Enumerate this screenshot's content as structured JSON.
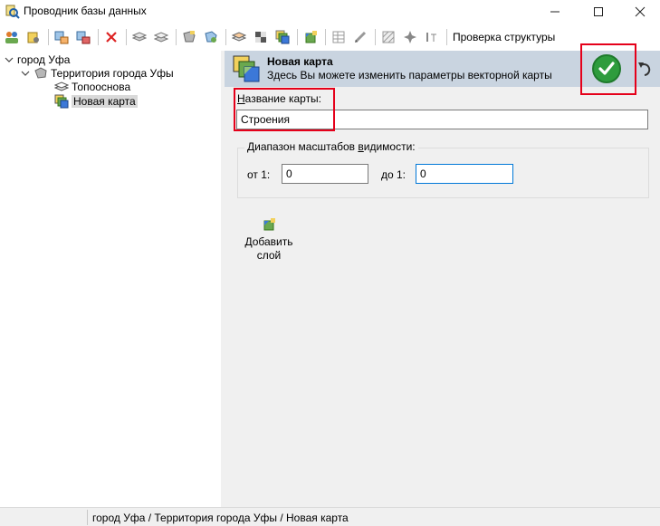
{
  "window": {
    "title": "Проводник базы данных",
    "app_icon": "magnifier-db-icon",
    "controls": [
      "minimize-icon",
      "maximize-icon",
      "close-icon"
    ]
  },
  "toolbar": {
    "buttons": [
      "users-icon",
      "user-settings-icon",
      "add-object-icon",
      "remove-object-icon",
      "delete-icon",
      "layers-icon",
      "layers-copy-icon",
      "territory-icon",
      "territory-settings-icon",
      "basemap-icon",
      "checker-icon",
      "add-map-icon",
      "add-layer-icon",
      "table-icon",
      "edit-icon",
      "grid-icon",
      "sparkle-icon",
      "text-tool-icon"
    ],
    "check_structure_label": "Проверка структуры"
  },
  "tree": {
    "root": "город Уфа",
    "territory": "Территория города Уфы",
    "basemap": "Топооснова",
    "new_map": "Новая карта"
  },
  "panel": {
    "title": "Новая карта",
    "subtitle": "Здесь Вы можете изменить параметры векторной карты",
    "map_name_label_prefix": "Н",
    "map_name_label_rest": "азвание карты:",
    "map_name_value": "Строения",
    "scale_group_label_a": "Диапазон масштабов ",
    "scale_group_label_u": "в",
    "scale_group_label_b": "идимости:",
    "from_label": "от 1:",
    "from_value": "0",
    "to_label": "до 1:",
    "to_value": "0",
    "add_layer_label_line1": "Добавить",
    "add_layer_label_line2": "слой"
  },
  "statusbar": {
    "path": "город Уфа / Территория города Уфы / Новая карта"
  },
  "colors": {
    "header_bg": "#c9d4e0",
    "apply_green": "#2e9c3d",
    "highlight_red": "#e5001a",
    "panel_bg": "#f0f0f0"
  }
}
